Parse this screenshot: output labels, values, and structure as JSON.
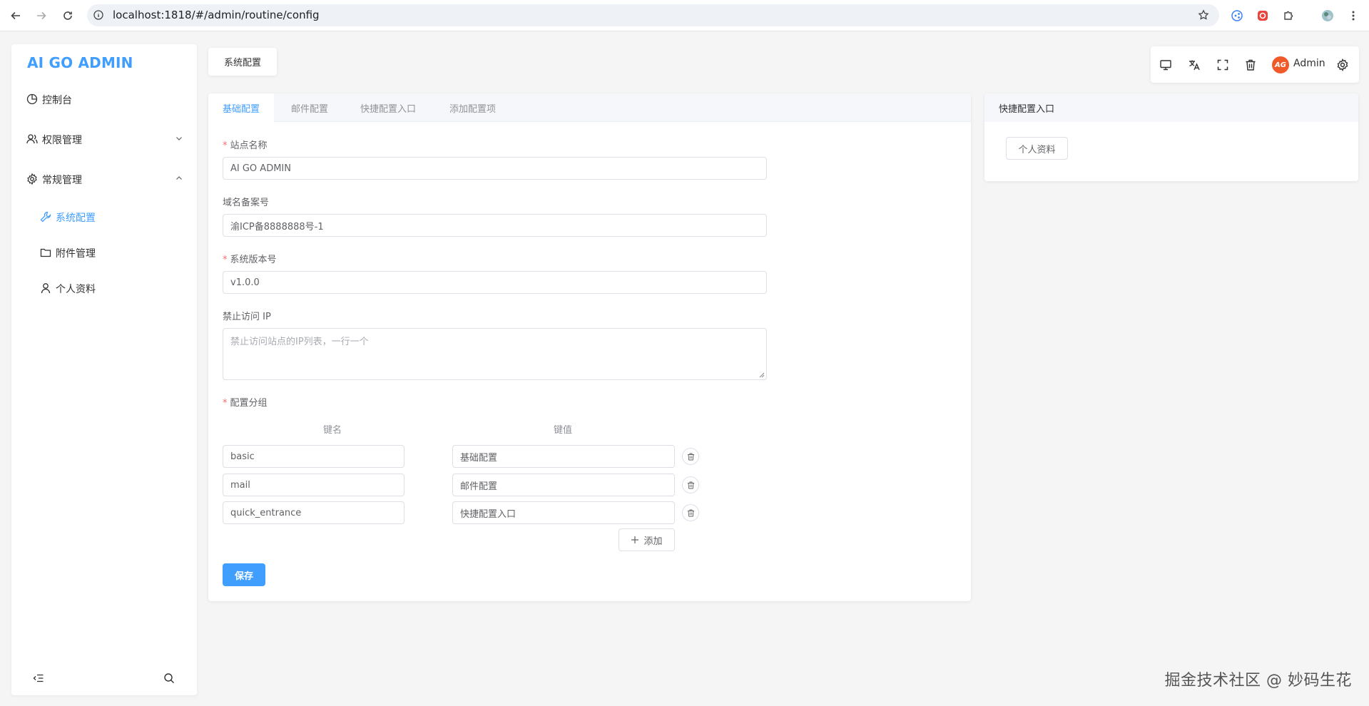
{
  "browser": {
    "url": "localhost:1818/#/admin/routine/config"
  },
  "sidebar": {
    "brand": "AI GO ADMIN",
    "items": [
      {
        "label": "控制台"
      },
      {
        "label": "权限管理"
      },
      {
        "label": "常规管理"
      }
    ],
    "sub_items": [
      {
        "label": "系统配置",
        "active": true
      },
      {
        "label": "附件管理",
        "active": false
      },
      {
        "label": "个人资料",
        "active": false
      }
    ]
  },
  "header": {
    "page_tab": "系统配置",
    "avatar_text": "AG",
    "user_name": "Admin"
  },
  "config": {
    "tabs": [
      "基础配置",
      "邮件配置",
      "快捷配置入口",
      "添加配置项"
    ],
    "active_tab": "基础配置",
    "fields": {
      "site_name_label": "站点名称",
      "site_name_value": "AI GO ADMIN",
      "icp_label": "域名备案号",
      "icp_value": "渝ICP备8888888号-1",
      "version_label": "系统版本号",
      "version_value": "v1.0.0",
      "deny_ip_label": "禁止访问 IP",
      "deny_ip_placeholder": "禁止访问站点的IP列表，一行一个",
      "group_label": "配置分组"
    },
    "group_table": {
      "key_header": "键名",
      "value_header": "键值",
      "rows": [
        {
          "key": "basic",
          "value": "基础配置"
        },
        {
          "key": "mail",
          "value": "邮件配置"
        },
        {
          "key": "quick_entrance",
          "value": "快捷配置入口"
        }
      ],
      "add_label": "添加"
    },
    "save_label": "保存"
  },
  "quick_entrance": {
    "title": "快捷配置入口",
    "button": "个人资料"
  },
  "watermark": "掘金技术社区 @ 妙码生花",
  "colors": {
    "accent": "#409eff",
    "required": "#f56c6c",
    "avatar": "#f05a28"
  }
}
